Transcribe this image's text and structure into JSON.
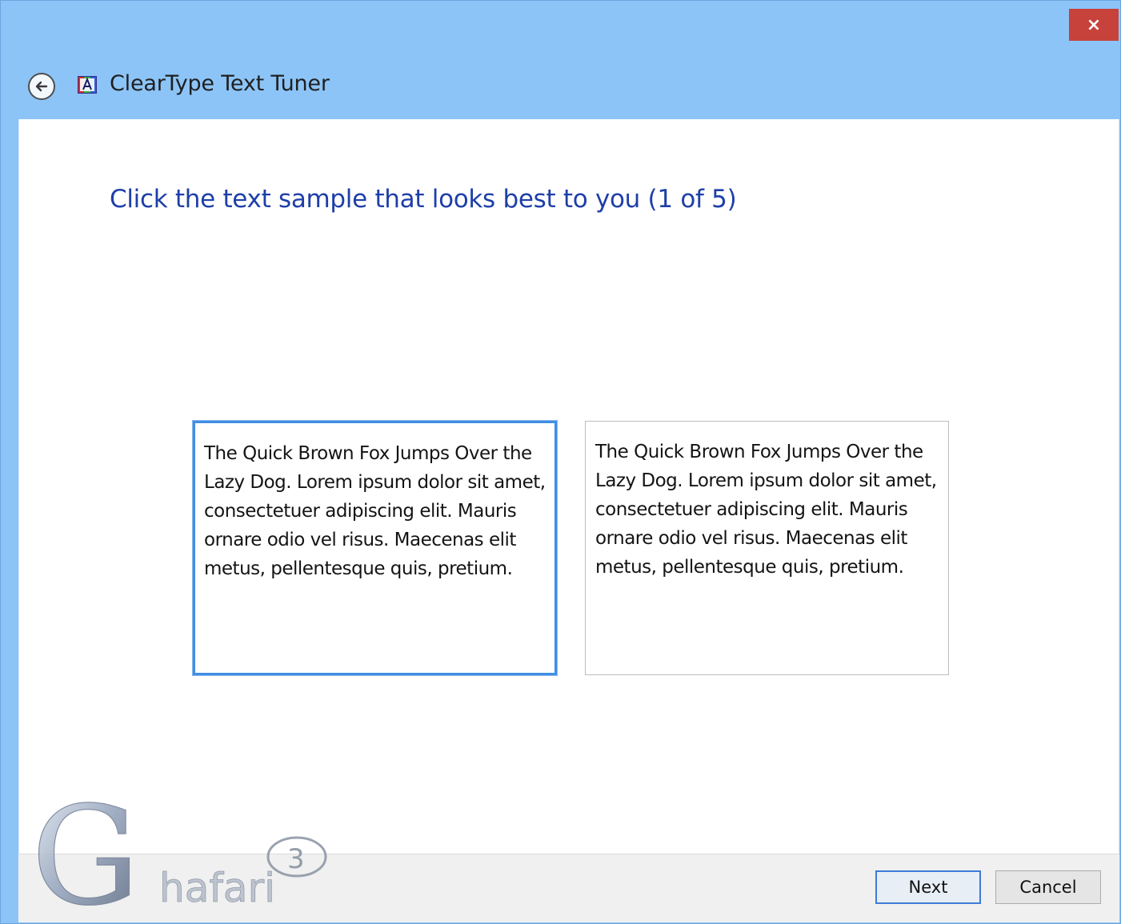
{
  "window": {
    "title": "ClearType Text Tuner",
    "close_label": "×",
    "title_bar_color": "#8cc4f7",
    "close_color": "#c7423b"
  },
  "icons": {
    "back": "back-arrow-icon",
    "app": "cleartype-app-icon",
    "close": "close-icon"
  },
  "main": {
    "instruction": "Click the text sample that looks best to you (1 of 5)",
    "instruction_color": "#1e3fa8",
    "samples": [
      {
        "text": "The Quick Brown Fox Jumps Over the Lazy Dog. Lorem ipsum dolor sit amet, consectetuer adipiscing elit. Mauris ornare odio vel risus. Maecenas elit metus, pellentesque quis, pretium.",
        "selected": true
      },
      {
        "text": "The Quick Brown Fox Jumps Over the Lazy Dog. Lorem ipsum dolor sit amet, consectetuer adipiscing elit. Mauris ornare odio vel risus. Maecenas elit metus, pellentesque quis, pretium.",
        "selected": false
      }
    ]
  },
  "footer": {
    "next_label": "Next",
    "cancel_label": "Cancel"
  },
  "watermark": {
    "big_letter": "G",
    "rest": "hafari",
    "circle_digit": "3"
  }
}
